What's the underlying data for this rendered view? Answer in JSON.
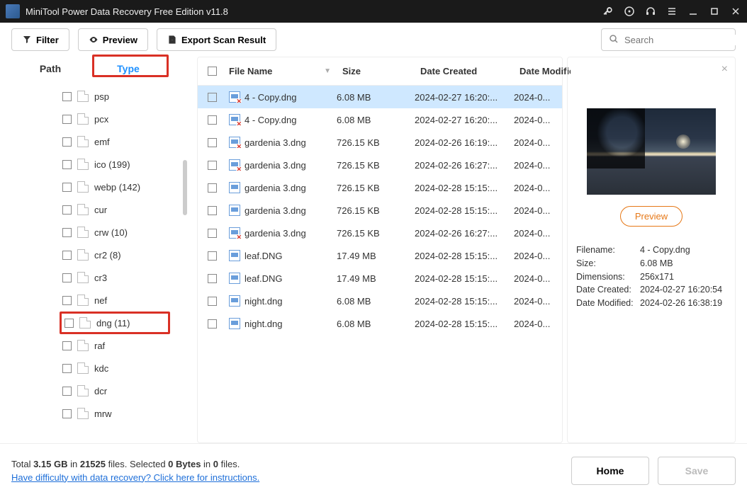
{
  "titlebar": {
    "title": "MiniTool Power Data Recovery Free Edition v11.8"
  },
  "toolbar": {
    "filter": "Filter",
    "preview": "Preview",
    "export": "Export Scan Result",
    "search_placeholder": "Search"
  },
  "tabs": {
    "path": "Path",
    "type": "Type"
  },
  "tree": [
    {
      "label": "psp"
    },
    {
      "label": "pcx"
    },
    {
      "label": "emf"
    },
    {
      "label": "ico (199)"
    },
    {
      "label": "webp (142)"
    },
    {
      "label": "cur"
    },
    {
      "label": "crw (10)"
    },
    {
      "label": "cr2 (8)"
    },
    {
      "label": "cr3"
    },
    {
      "label": "nef"
    },
    {
      "label": "dng (11)",
      "selected": true
    },
    {
      "label": "raf"
    },
    {
      "label": "kdc"
    },
    {
      "label": "dcr"
    },
    {
      "label": "mrw"
    }
  ],
  "columns": {
    "name": "File Name",
    "size": "Size",
    "created": "Date Created",
    "modified": "Date Modifie"
  },
  "files": [
    {
      "name": "4 - Copy.dng",
      "size": "6.08 MB",
      "created": "2024-02-27 16:20:...",
      "modified": "2024-0...",
      "deleted": true,
      "selected": true
    },
    {
      "name": "4 - Copy.dng",
      "size": "6.08 MB",
      "created": "2024-02-27 16:20:...",
      "modified": "2024-0...",
      "deleted": true
    },
    {
      "name": "gardenia 3.dng",
      "size": "726.15 KB",
      "created": "2024-02-26 16:19:...",
      "modified": "2024-0...",
      "deleted": true
    },
    {
      "name": "gardenia 3.dng",
      "size": "726.15 KB",
      "created": "2024-02-26 16:27:...",
      "modified": "2024-0...",
      "deleted": true
    },
    {
      "name": "gardenia 3.dng",
      "size": "726.15 KB",
      "created": "2024-02-28 15:15:...",
      "modified": "2024-0..."
    },
    {
      "name": "gardenia 3.dng",
      "size": "726.15 KB",
      "created": "2024-02-28 15:15:...",
      "modified": "2024-0..."
    },
    {
      "name": "gardenia 3.dng",
      "size": "726.15 KB",
      "created": "2024-02-26 16:27:...",
      "modified": "2024-0...",
      "deleted": true
    },
    {
      "name": "leaf.DNG",
      "size": "17.49 MB",
      "created": "2024-02-28 15:15:...",
      "modified": "2024-0..."
    },
    {
      "name": "leaf.DNG",
      "size": "17.49 MB",
      "created": "2024-02-28 15:15:...",
      "modified": "2024-0..."
    },
    {
      "name": "night.dng",
      "size": "6.08 MB",
      "created": "2024-02-28 15:15:...",
      "modified": "2024-0..."
    },
    {
      "name": "night.dng",
      "size": "6.08 MB",
      "created": "2024-02-28 15:15:...",
      "modified": "2024-0..."
    }
  ],
  "preview": {
    "button": "Preview",
    "meta": {
      "filename_k": "Filename:",
      "filename_v": "4 - Copy.dng",
      "size_k": "Size:",
      "size_v": "6.08 MB",
      "dim_k": "Dimensions:",
      "dim_v": "256x171",
      "created_k": "Date Created:",
      "created_v": "2024-02-27 16:20:54",
      "modified_k": "Date Modified:",
      "modified_v": "2024-02-26 16:38:19"
    }
  },
  "footer": {
    "total_prefix": "Total ",
    "total_size": "3.15 GB",
    "in1": " in ",
    "total_files": "21525",
    "files_suffix": " files.  ",
    "selected_prefix": "Selected ",
    "sel_bytes": "0 Bytes",
    "in2": " in ",
    "sel_files": "0",
    "sel_suffix": " files.",
    "help": "Have difficulty with data recovery? Click here for instructions.",
    "home": "Home",
    "save": "Save"
  }
}
